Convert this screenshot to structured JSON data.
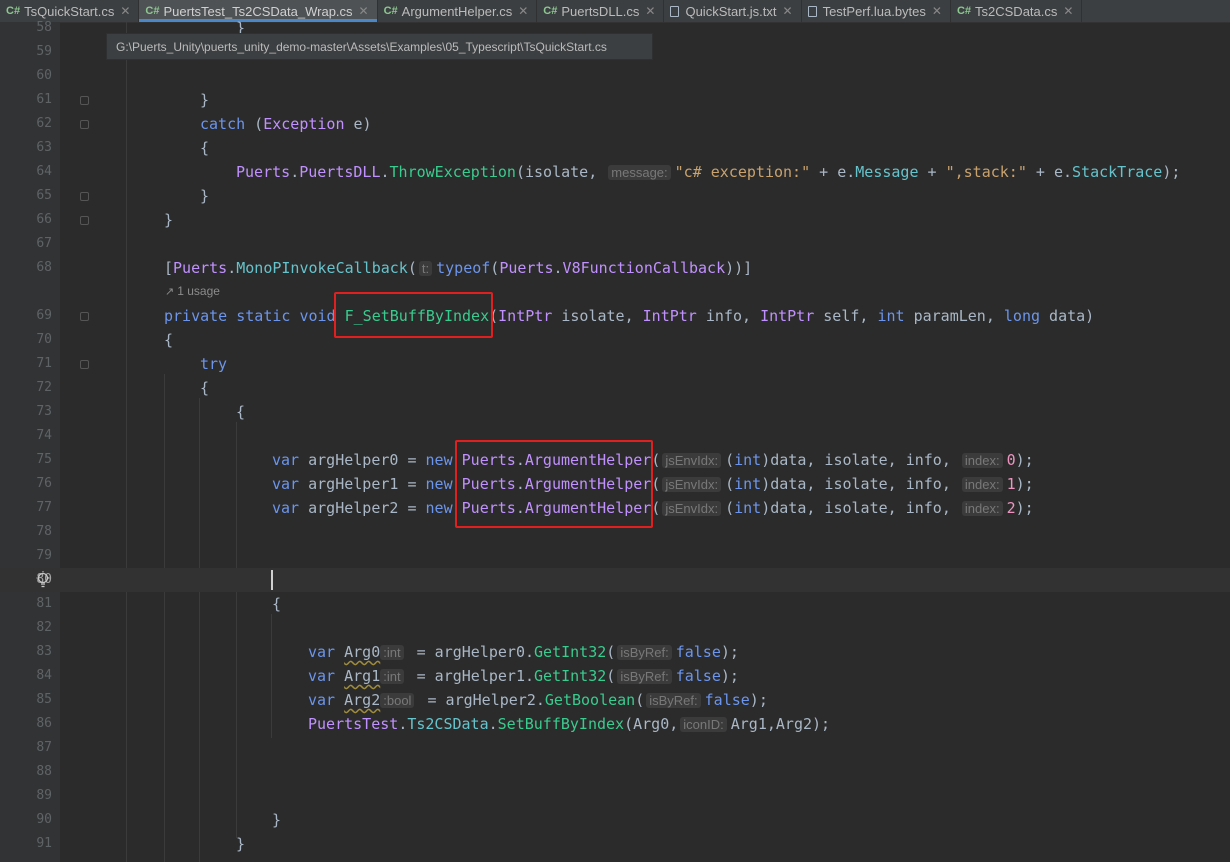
{
  "tabs": [
    {
      "lang": "C#",
      "label": "TsQuickStart.cs",
      "active": false,
      "closable": true
    },
    {
      "lang": "C#",
      "label": "PuertsTest_Ts2CSData_Wrap.cs",
      "active": true,
      "closable": true
    },
    {
      "lang": "C#",
      "label": "ArgumentHelper.cs",
      "active": false,
      "closable": true
    },
    {
      "lang": "C#",
      "label": "PuertsDLL.cs",
      "active": false,
      "closable": true
    },
    {
      "lang": "",
      "label": "QuickStart.js.txt",
      "active": false,
      "closable": true
    },
    {
      "lang": "",
      "label": "TestPerf.lua.bytes",
      "active": false,
      "closable": true
    },
    {
      "lang": "C#",
      "label": "Ts2CSData.cs",
      "active": false,
      "closable": true
    }
  ],
  "tooltip": {
    "path": "G:\\Puerts_Unity\\puerts_unity_demo-master\\Assets\\Examples\\05_Typescript\\TsQuickStart.cs"
  },
  "usage": {
    "text": "1 usage"
  },
  "lines": {
    "n58": "58",
    "n59": "59",
    "n60": "60",
    "n61": "61",
    "n62": "62",
    "n63": "63",
    "n64": "64",
    "n65": "65",
    "n66": "66",
    "n67": "67",
    "n68": "68",
    "n69": "69",
    "n70": "70",
    "n71": "71",
    "n72": "72",
    "n73": "73",
    "n74": "74",
    "n75": "75",
    "n76": "76",
    "n77": "77",
    "n78": "78",
    "n79": "79",
    "n80": "80",
    "n81": "81",
    "n82": "82",
    "n83": "83",
    "n84": "84",
    "n85": "85",
    "n86": "86",
    "n87": "87",
    "n88": "88",
    "n89": "89",
    "n90": "90",
    "n91": "91"
  },
  "code": {
    "l58": "}",
    "l61": "}",
    "l62_kw": "catch",
    "l62_rest_a": " (",
    "l62_type": "Exception",
    "l62_rest_b": " e)",
    "l63": "{",
    "l64_ns": "Puerts",
    "l64_dot1": ".",
    "l64_cls": "PuertsDLL",
    "l64_dot2": ".",
    "l64_fn": "ThrowException",
    "l64_a": "(isolate, ",
    "l64_hint": "message:",
    "l64_str1": "\"c# exception:\"",
    "l64_b": " + e.",
    "l64_mem1": "Message",
    "l64_c": " + ",
    "l64_str2": "\",stack:\"",
    "l64_d": " + e.",
    "l64_mem2": "StackTrace",
    "l64_e": ");",
    "l65": "}",
    "l66": "}",
    "l68_a": "[",
    "l68_ns": "Puerts",
    "l68_dot": ".",
    "l68_attr": "MonoPInvokeCallback",
    "l68_b": "(",
    "l68_hint": "t:",
    "l68_kw": "typeof",
    "l68_c": "(",
    "l68_ns2": "Puerts",
    "l68_dot2": ".",
    "l68_ty": "V8FunctionCallback",
    "l68_d": "))]",
    "l69_kw": "private static void",
    "l69_fn": "F_SetBuffByIndex",
    "l69_a": "(",
    "l69_t1": "IntPtr",
    "l69_b": " isolate, ",
    "l69_t2": "IntPtr",
    "l69_c": " info, ",
    "l69_t3": "IntPtr",
    "l69_d": " self, ",
    "l69_t4": "int",
    "l69_e": " paramLen, ",
    "l69_t5": "long",
    "l69_f": " data)",
    "l70": "{",
    "l71": "try",
    "l72": "{",
    "l73": "{",
    "l75_var": "var",
    "l75_name": " argHelper0 = ",
    "l75_new": "new",
    "l75_ns": "Puerts",
    "l75_dot": ".",
    "l75_cls": "ArgumentHelper",
    "l75_p": "(",
    "l75_hint1": "jsEnvIdx:",
    "l75_a": "(",
    "l75_int": "int",
    "l75_b": ")data, isolate, info, ",
    "l75_hint2": "index:",
    "l75_num": "0",
    "l75_c": ");",
    "l76_var": "var",
    "l76_name": " argHelper1 = ",
    "l76_new": "new",
    "l76_ns": "Puerts",
    "l76_dot": ".",
    "l76_cls": "ArgumentHelper",
    "l76_p": "(",
    "l76_hint1": "jsEnvIdx:",
    "l76_a": "(",
    "l76_int": "int",
    "l76_b": ")data, isolate, info, ",
    "l76_hint2": "index:",
    "l76_num": "1",
    "l76_c": ");",
    "l77_var": "var",
    "l77_name": " argHelper2 = ",
    "l77_new": "new",
    "l77_ns": "Puerts",
    "l77_dot": ".",
    "l77_cls": "ArgumentHelper",
    "l77_p": "(",
    "l77_hint1": "jsEnvIdx:",
    "l77_a": "(",
    "l77_int": "int",
    "l77_b": ")data, isolate, info, ",
    "l77_hint2": "index:",
    "l77_num": "2",
    "l77_c": ");",
    "l81": "{",
    "l83_var": "var",
    "l83_name": "Arg0",
    "l83_hint": ":int",
    "l83_a": " = argHelper0.",
    "l83_fn": "GetInt32",
    "l83_p": "(",
    "l83_hint2": "isByRef:",
    "l83_kw": "false",
    "l83_e": ");",
    "l84_var": "var",
    "l84_name": "Arg1",
    "l84_hint": ":int",
    "l84_a": " = argHelper1.",
    "l84_fn": "GetInt32",
    "l84_p": "(",
    "l84_hint2": "isByRef:",
    "l84_kw": "false",
    "l84_e": ");",
    "l85_var": "var",
    "l85_name": "Arg2",
    "l85_hint": ":bool",
    "l85_a": " = argHelper2.",
    "l85_fn": "GetBoolean",
    "l85_p": "(",
    "l85_hint2": "isByRef:",
    "l85_kw": "false",
    "l85_e": ");",
    "l86_ns": "PuertsTest",
    "l86_dot1": ".",
    "l86_cls": "Ts2CSData",
    "l86_dot2": ".",
    "l86_fn": "SetBuffByIndex",
    "l86_a": "(Arg0,",
    "l86_hint": "iconID:",
    "l86_b": "Arg1,Arg2);",
    "l90": "}",
    "l91": "}"
  },
  "colors": {
    "background": "#2b2b2b",
    "keyword": "#cc7832",
    "function": "#39cc8f",
    "string": "#c9a26d",
    "type": "#c191ff",
    "member": "#66c3cc",
    "number": "#ed94c0",
    "highlight_box": "#e02020"
  },
  "icons": {
    "bulb": "lightbulb-icon",
    "fold": "fold-marker-icon",
    "usage": "usage-arrow-icon"
  }
}
